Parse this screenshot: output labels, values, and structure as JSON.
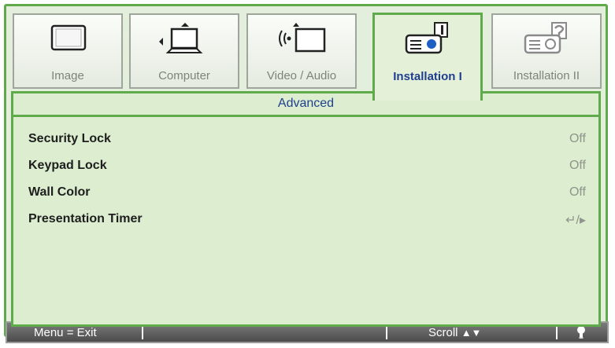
{
  "tabs": [
    {
      "label": "Image",
      "icon": "image-icon",
      "active": false
    },
    {
      "label": "Computer",
      "icon": "computer-icon",
      "active": false
    },
    {
      "label": "Video / Audio",
      "icon": "video-audio-icon",
      "active": false
    },
    {
      "label": "Installation I",
      "icon": "projector-icon",
      "active": true
    },
    {
      "label": "Installation II",
      "icon": "projector-settings-icon",
      "active": false
    }
  ],
  "panel": {
    "title": "Advanced",
    "items": [
      {
        "label": "Security Lock",
        "value": "Off"
      },
      {
        "label": "Keypad Lock",
        "value": "Off"
      },
      {
        "label": "Wall Color",
        "value": "Off"
      },
      {
        "label": "Presentation Timer",
        "value": "↵/▸"
      }
    ]
  },
  "statusbar": {
    "menu": "Menu = Exit",
    "scroll": "Scroll",
    "scroll_glyph": "▲▼"
  },
  "colors": {
    "accent": "#5faa4a",
    "background": "#dceecf",
    "highlight_text": "#1f3f8e"
  }
}
